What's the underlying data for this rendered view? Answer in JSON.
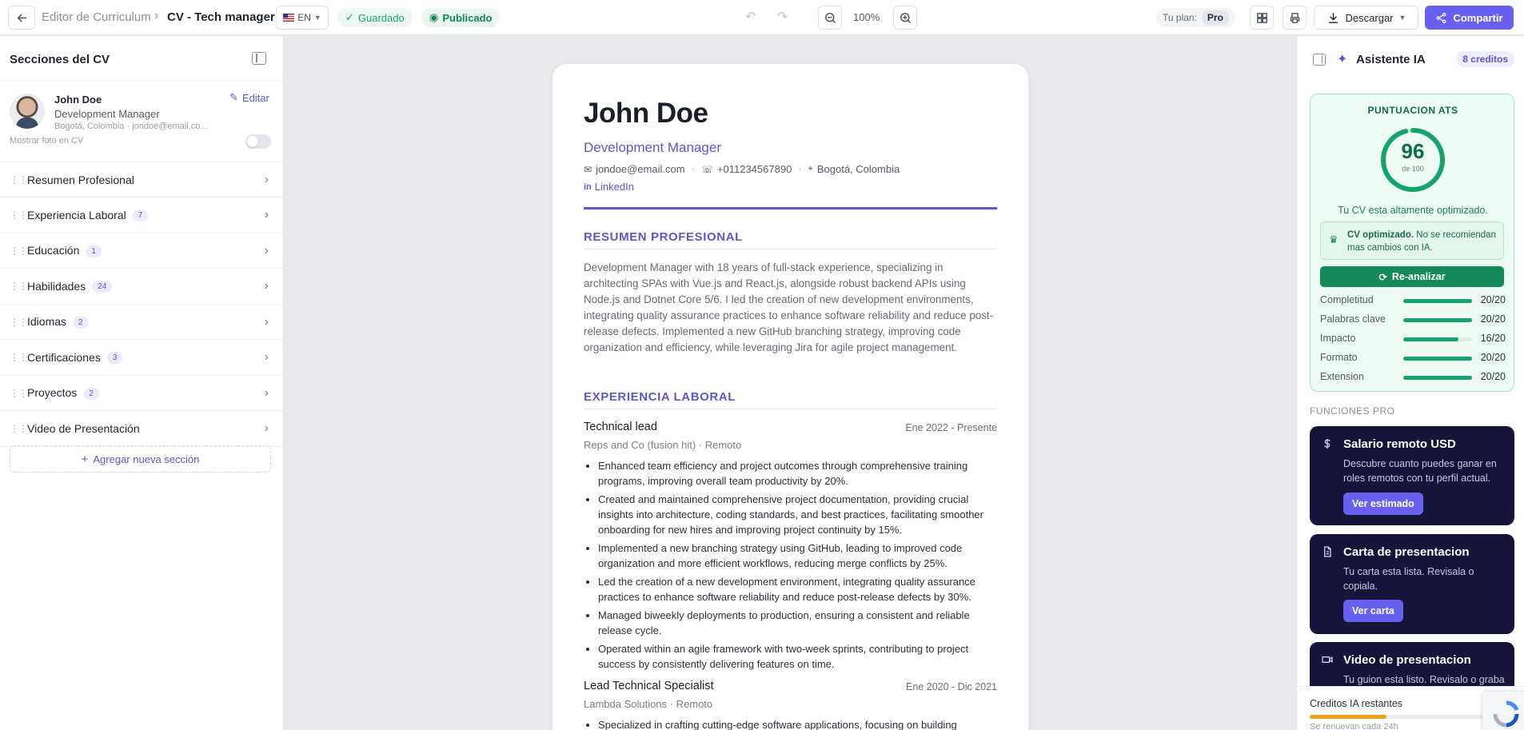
{
  "header": {
    "crumb_parent": "Editor de Curriculum",
    "crumb_current": "CV - Tech manager",
    "lang": "EN",
    "saved": "Guardado",
    "published": "Publicado",
    "zoom": "100%",
    "plan_label": "Tu plan:",
    "plan_value": "Pro",
    "download": "Descargar",
    "share": "Compartir"
  },
  "sidebar": {
    "title": "Secciones del CV",
    "profile": {
      "name": "John Doe",
      "role": "Development Manager",
      "location": "Bogotá, Colombia · jondoe@email.co...",
      "edit": "Editar",
      "photo_toggle": "Mostrar foto en CV"
    },
    "sections": [
      {
        "label": "Resumen Profesional",
        "count": ""
      },
      {
        "label": "Experiencia Laboral",
        "count": "7"
      },
      {
        "label": "Educación",
        "count": "1"
      },
      {
        "label": "Habilidades",
        "count": "24"
      },
      {
        "label": "Idiomas",
        "count": "2"
      },
      {
        "label": "Certificaciones",
        "count": "3"
      },
      {
        "label": "Proyectos",
        "count": "2"
      },
      {
        "label": "Video de Presentación",
        "count": ""
      }
    ],
    "add_section": "Agregar nueva sección"
  },
  "cv": {
    "name": "John Doe",
    "title": "Development Manager",
    "email": "jondoe@email.com",
    "phone": "+011234567890",
    "location": "Bogotá, Colombia",
    "linkedin": "LinkedIn",
    "sep": "·",
    "summary_heading": "RESUMEN PROFESIONAL",
    "summary": "Development Manager with 18 years of full-stack experience, specializing in architecting SPAs with Vue.js and React.js, alongside robust backend APIs using Node.js and Dotnet Core 5/6. I led the creation of new development environments, integrating quality assurance practices to enhance software reliability and reduce post-release defects. Implemented a new GitHub branching strategy, improving code organization and efficiency, while leveraging Jira for agile project management.",
    "experience_heading": "EXPERIENCIA LABORAL",
    "jobs": [
      {
        "title": "Technical lead",
        "dates": "Ene 2022 - Presente",
        "company": "Reps and Co (fusion hit) · Remoto",
        "bullets": [
          "Enhanced team efficiency and project outcomes through comprehensive training programs, improving overall team productivity by 20%.",
          "Created and maintained comprehensive project documentation, providing crucial insights into architecture, coding standards, and best practices, facilitating smoother onboarding for new hires and improving project continuity by 15%.",
          "Implemented a new branching strategy using GitHub, leading to improved code organization and more efficient workflows, reducing merge conflicts by 25%.",
          "Led the creation of a new development environment, integrating quality assurance practices to enhance software reliability and reduce post-release defects by 30%.",
          "Managed biweekly deployments to production, ensuring a consistent and reliable release cycle.",
          "Operated within an agile framework with two-week sprints, contributing to project success by consistently delivering features on time."
        ]
      },
      {
        "title": "Lead Technical Specialist",
        "dates": "Ene 2020 - Dic 2021",
        "company": "Lambda Solutions · Remoto",
        "bullets": [
          "Specialized in crafting cutting-edge software applications, focusing on building"
        ]
      }
    ]
  },
  "assistant": {
    "title": "Asistente IA",
    "credits": "8 creditos",
    "ats_label": "PUNTUACION ATS",
    "score": "96",
    "score_of": "de 100",
    "score_value": 96,
    "optimized_msg": "Tu CV esta altamente optimizado.",
    "note_bold": "CV optimizado.",
    "note_rest": " No se recomiendan mas cambios con IA.",
    "reanalyze": "Re-analizar",
    "metrics": [
      {
        "label": "Completitud",
        "value": "20/20",
        "fraction": 1
      },
      {
        "label": "Palabras clave",
        "value": "20/20",
        "fraction": 1
      },
      {
        "label": "Impacto",
        "value": "16/20",
        "fraction": 0.8
      },
      {
        "label": "Formato",
        "value": "20/20",
        "fraction": 1
      },
      {
        "label": "Extension",
        "value": "20/20",
        "fraction": 1
      }
    ],
    "pro_heading": "FUNCIONES PRO",
    "pro": [
      {
        "title": "Salario remoto USD",
        "desc": "Descubre cuanto puedes ganar en roles remotos con tu perfil actual.",
        "button": "Ver estimado"
      },
      {
        "title": "Carta de presentacion",
        "desc": "Tu carta esta lista. Revisala o copiala.",
        "button": "Ver carta"
      },
      {
        "title": "Video de presentacion",
        "desc": "Tu guion esta listo. Revisalo o graba"
      }
    ],
    "credits_footer": "Creditos IA restantes",
    "renew": "Se renuevan cada 24h",
    "credits_fraction": 0.4
  },
  "colors": {
    "accent": "#6861f0",
    "cv_accent": "#5b57d1",
    "green": "#16a36a",
    "pro_bg": "#16143a"
  }
}
